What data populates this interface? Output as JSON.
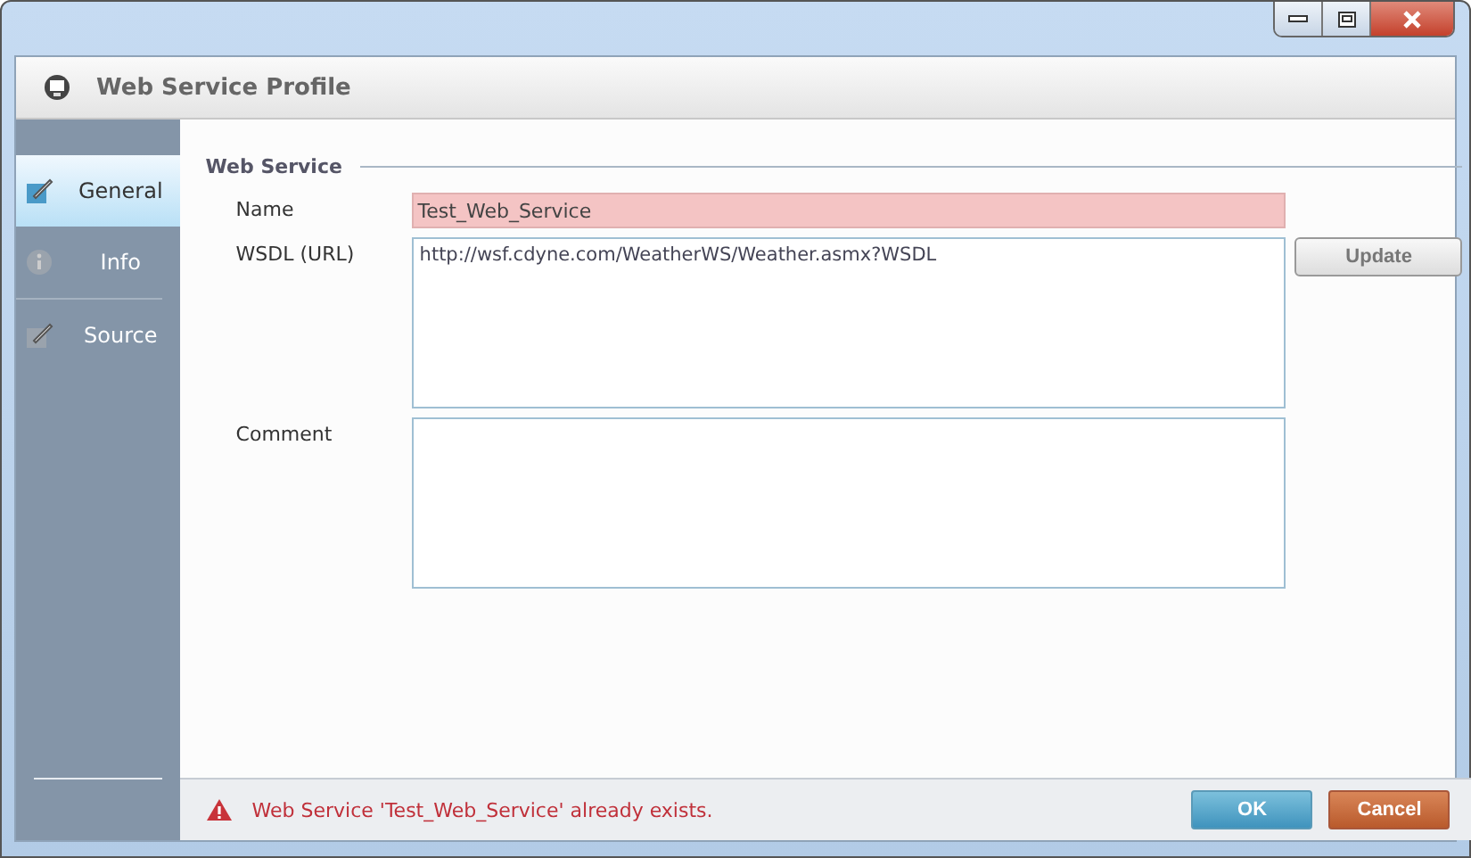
{
  "window": {
    "title": "Web Service Profile"
  },
  "sidebar": {
    "items": [
      {
        "label": "General",
        "kind": "edit",
        "selected": true
      },
      {
        "label": "Info",
        "kind": "info",
        "selected": false
      },
      {
        "label": "Source",
        "kind": "source",
        "selected": false
      }
    ]
  },
  "section": {
    "title": "Web Service"
  },
  "fields": [
    {
      "label": "Name",
      "kind": "line",
      "value": "Test_Web_Service",
      "invalid": true
    },
    {
      "label": "WSDL (URL)",
      "kind": "area",
      "value": "http://wsf.cdyne.com/WeatherWS/Weather.asmx?WSDL",
      "invalid": false,
      "button": "Update"
    },
    {
      "label": "Comment",
      "kind": "area",
      "invalid": false
    }
  ],
  "status": {
    "message": "Web Service 'Test_Web_Service' already exists.",
    "error": true
  },
  "buttons": [
    {
      "label": "OK",
      "kind": "primary"
    },
    {
      "label": "Cancel",
      "kind": "danger"
    }
  ]
}
